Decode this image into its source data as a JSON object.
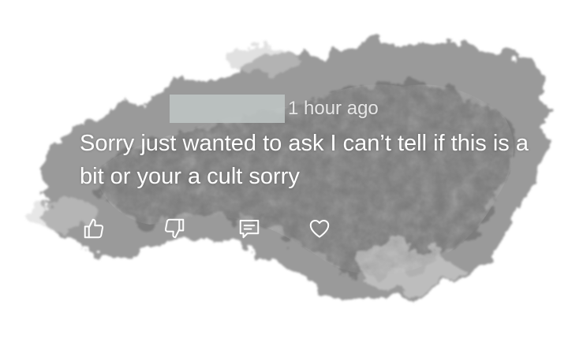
{
  "comment": {
    "author_redacted": true,
    "timestamp": "1 hour ago",
    "text": "Sorry just wanted to ask I can’t tell if this is a bit or your a cult sorry"
  },
  "actions": [
    {
      "icon": "thumbs-up-icon"
    },
    {
      "icon": "thumbs-down-icon"
    },
    {
      "icon": "reply-icon"
    },
    {
      "icon": "heart-icon"
    }
  ],
  "colors": {
    "text": "#ffffff",
    "timestamp": "#e6e6e6",
    "cloud_dark": "#6f6f6f",
    "cloud_light": "#d8d8d8",
    "redaction": "#bfc7c5"
  }
}
